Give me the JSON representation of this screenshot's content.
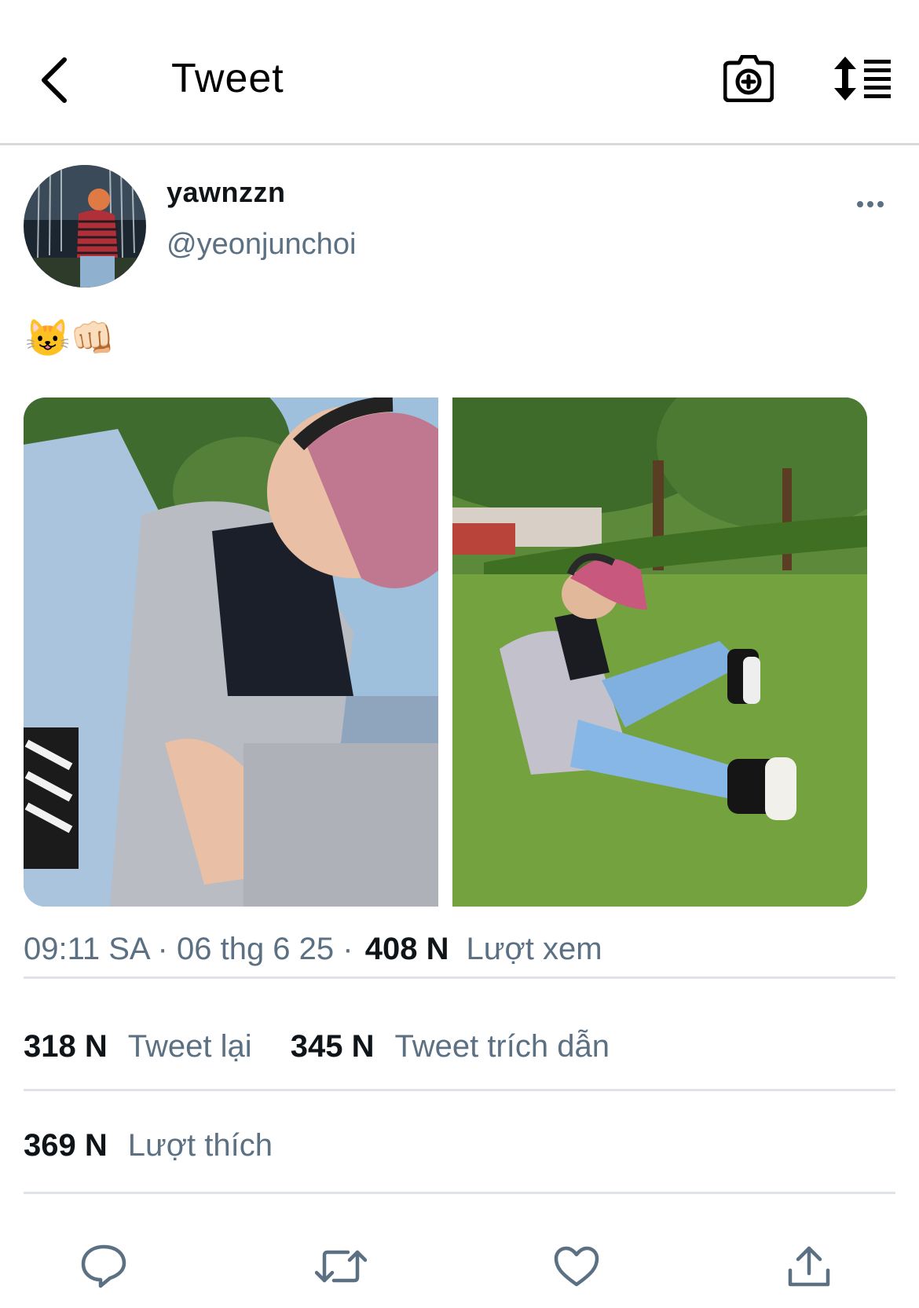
{
  "header": {
    "title": "Tweet",
    "back_icon": "chevron-left-icon",
    "camera_icon": "camera-plus-icon",
    "sort_icon": "sort-list-icon"
  },
  "author": {
    "name": "yawnzzn",
    "handle": "@yeonjunchoi"
  },
  "tweet": {
    "text": "😺👊🏻"
  },
  "meta": {
    "time": "09:11 SA",
    "separator": "·",
    "date": "06 thg 6 25",
    "views_count": "408 N",
    "views_label": "Lượt xem"
  },
  "stats": {
    "retweets_count": "318 N",
    "retweets_label": "Tweet lại",
    "quotes_count": "345 N",
    "quotes_label": "Tweet trích dẫn",
    "likes_count": "369 N",
    "likes_label": "Lượt thích"
  },
  "colors": {
    "text": "#0f1419",
    "muted": "#5b7083",
    "divider": "#e0e4e8"
  }
}
